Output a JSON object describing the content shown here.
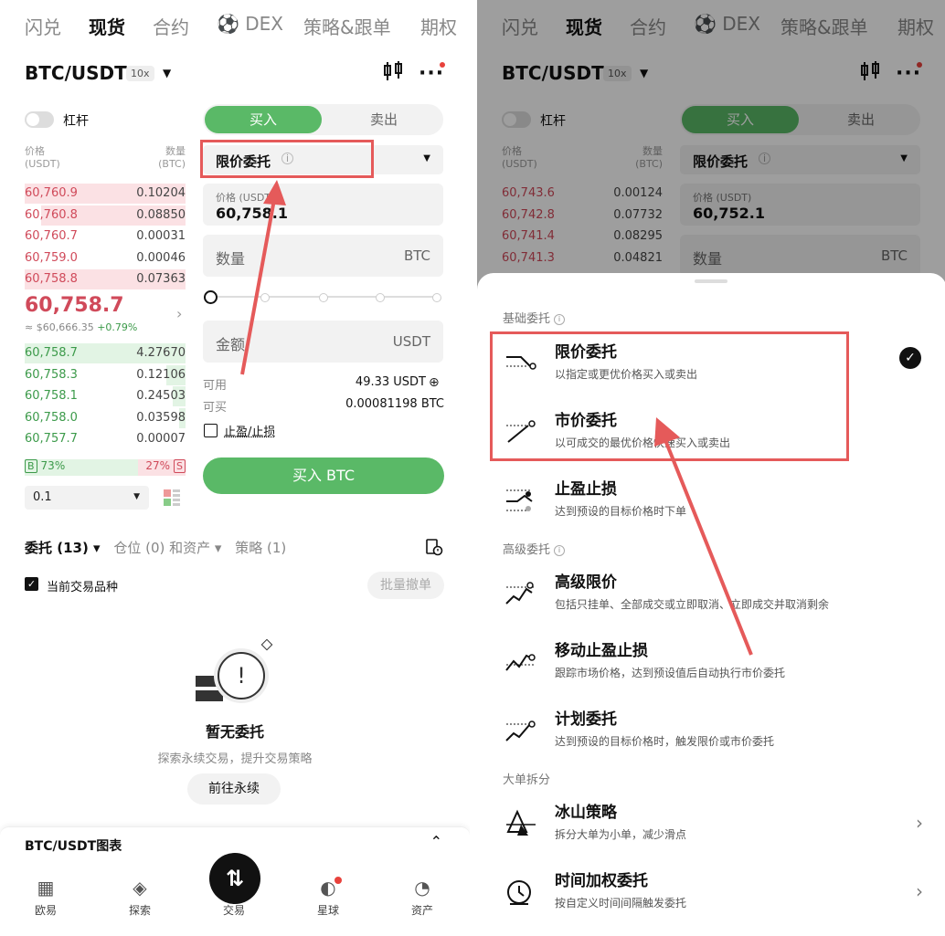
{
  "tabs": [
    "闪兑",
    "现货",
    "合约",
    "DEX",
    "策略&跟单",
    "期权"
  ],
  "pair": {
    "symbol": "BTC/USDT",
    "leverage": "10x"
  },
  "leverage_label": "杠杆",
  "orderbook": {
    "price_header": "价格",
    "price_unit": "(USDT)",
    "qty_header": "数量",
    "qty_unit": "(BTC)",
    "asks": [
      {
        "price": "60,760.9",
        "qty": "0.10204",
        "depth": 1.0
      },
      {
        "price": "60,760.8",
        "qty": "0.08850",
        "depth": 0.9
      },
      {
        "price": "60,760.7",
        "qty": "0.00031",
        "depth": 0.0
      },
      {
        "price": "60,759.0",
        "qty": "0.00046",
        "depth": 0.0
      },
      {
        "price": "60,758.8",
        "qty": "0.07363",
        "depth": 1.0
      }
    ],
    "last_price": "60,758.7",
    "last_sub": "≈ $60,666.35",
    "last_change": "+0.79%",
    "bids": [
      {
        "price": "60,758.7",
        "qty": "4.27670",
        "depth": 1.0
      },
      {
        "price": "60,758.3",
        "qty": "0.12106",
        "depth": 0.12
      },
      {
        "price": "60,758.1",
        "qty": "0.24503",
        "depth": 0.08
      },
      {
        "price": "60,758.0",
        "qty": "0.03598",
        "depth": 0.04
      },
      {
        "price": "60,757.7",
        "qty": "0.00007",
        "depth": 0.0
      }
    ],
    "buy_ratio": "73%",
    "sell_ratio": "27%",
    "buy_letter": "B",
    "sell_letter": "S",
    "depth": "0.1"
  },
  "form": {
    "buy": "买入",
    "sell": "卖出",
    "order_type": "限价委托",
    "price_label": "价格 (USDT)",
    "price_value": "60,758.1",
    "qty_placeholder": "数量",
    "qty_unit": "BTC",
    "amount_placeholder": "金额",
    "amount_unit": "USDT",
    "available_label": "可用",
    "available_value": "49.33 USDT",
    "can_buy_label": "可买",
    "can_buy_value": "0.00081198 BTC",
    "tpsl_label": "止盈/止损",
    "buy_button": "买入 BTC"
  },
  "orders": {
    "tab_orders": "委托 (13)",
    "tab_positions": "仓位 (0) 和资产",
    "tab_strategy": "策略 (1)",
    "current_only": "当前交易品种",
    "batch_cancel": "批量撤单",
    "empty_title": "暂无委托",
    "empty_sub": "探索永续交易，提升交易策略",
    "go_perp": "前往永续",
    "chart_bar": "BTC/USDT图表"
  },
  "nav": [
    "欧易",
    "探索",
    "交易",
    "星球",
    "资产"
  ],
  "right": {
    "orderbook_asks": [
      {
        "price": "60,743.6",
        "qty": "0.00124"
      },
      {
        "price": "60,742.8",
        "qty": "0.07732"
      },
      {
        "price": "60,741.4",
        "qty": "0.08295"
      },
      {
        "price": "60,741.3",
        "qty": "0.04821"
      }
    ],
    "price_value": "60,752.1",
    "section_basic": "基础委托",
    "section_advanced": "高级委托",
    "section_split": "大单拆分",
    "options": [
      {
        "title": "限价委托",
        "desc": "以指定或更优价格买入或卖出"
      },
      {
        "title": "市价委托",
        "desc": "以可成交的最优价格快速买入或卖出"
      },
      {
        "title": "止盈止损",
        "desc": "达到预设的目标价格时下单"
      },
      {
        "title": "高级限价",
        "desc": "包括只挂单、全部成交或立即取消、立即成交并取消剩余"
      },
      {
        "title": "移动止盈止损",
        "desc": "跟踪市场价格，达到预设值后自动执行市价委托"
      },
      {
        "title": "计划委托",
        "desc": "达到预设的目标价格时，触发限价或市价委托"
      },
      {
        "title": "冰山策略",
        "desc": "拆分大单为小单，减少滑点"
      },
      {
        "title": "时间加权委托",
        "desc": "按自定义时间间隔触发委托"
      }
    ]
  },
  "colors": {
    "green": "#5ab967",
    "red": "#d04a5a",
    "annotation": "#e55a5a"
  }
}
